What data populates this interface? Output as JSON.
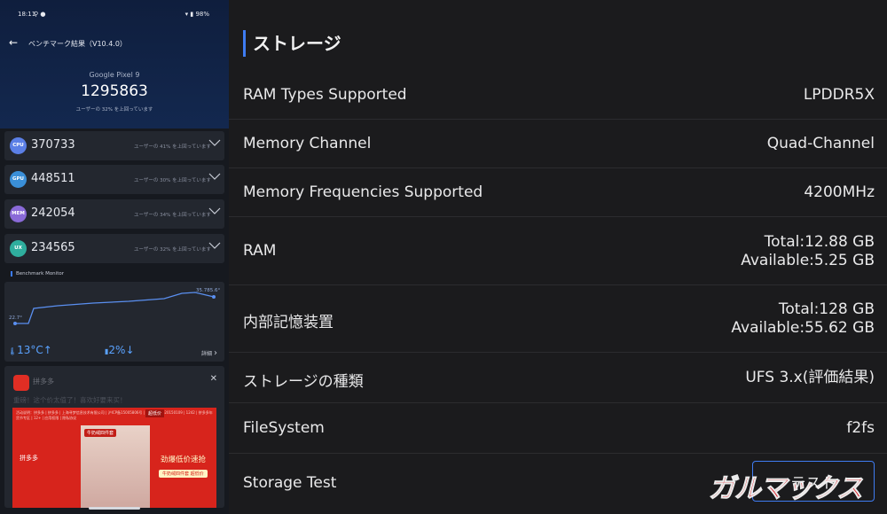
{
  "status_bar": {
    "time": "18:11",
    "battery": "98%"
  },
  "benchmark": {
    "title": "ベンチマーク結果（V10.4.0）",
    "device": "Google Pixel 9",
    "total_score": "1295863",
    "total_sub": "ユーザーの 32% を上回っています",
    "rows": [
      {
        "badge": "CPU",
        "score": "370733",
        "percentile": "ユーザーの 41% を上回っています",
        "color": "#5b7fe6"
      },
      {
        "badge": "GPU",
        "score": "448511",
        "percentile": "ユーザーの 30% を上回っています",
        "color": "#3a8fd8"
      },
      {
        "badge": "MEM",
        "score": "242054",
        "percentile": "ユーザーの 34% を上回っています",
        "color": "#8a6ad8"
      },
      {
        "badge": "UX",
        "score": "234565",
        "percentile": "ユーザーの 32% を上回っています",
        "color": "#2fae9e"
      }
    ]
  },
  "monitor": {
    "label": "Benchmark Monitor",
    "temp_start": "22.7°",
    "temp_end": "35.785.6°",
    "temp_rise": "13°C↑",
    "battery_drop": "2%↓",
    "details": "詳細"
  },
  "ad": {
    "brand": "拼多多",
    "headline": "重磅！这个价太值了！喜欢好要来买！",
    "fineprint": "活动说明：拼多多 | 拼多多 | 上海寻梦信息技术有限公司 | 沪ICP备15005806号 | ICP证沪B2-20150109 | 1242 | 拼多多年货节专区 | 12+ | 应用权限 | 隐私协议",
    "photo_tag": "牛奶绒四件套",
    "deal_badge": "超低价",
    "pdd_logo": "拼多多",
    "promo_line1": "劲爆低价速抢",
    "promo_line2": "牛奶绒四件套 超低价"
  },
  "storage": {
    "section_title": "ストレージ",
    "rows": [
      {
        "label": "RAM Types Supported",
        "value": "LPDDR5X"
      },
      {
        "label": "Memory Channel",
        "value": "Quad-Channel"
      },
      {
        "label": "Memory Frequencies Supported",
        "value": "4200MHz"
      },
      {
        "label": "RAM",
        "value": "Total:12.88 GB",
        "value2": "Available:5.25 GB"
      },
      {
        "label": "内部記憶装置",
        "value": "Total:128 GB",
        "value2": "Available:55.62 GB"
      },
      {
        "label": "ストレージの種類",
        "value": "UFS 3.x(評価結果)"
      },
      {
        "label": "FileSystem",
        "value": "f2fs"
      },
      {
        "label": "Storage Test",
        "button": "テスト"
      }
    ]
  },
  "watermark": "ガルマックス",
  "colors": {
    "accent": "#3f7cf2",
    "background": "#1b1b1d",
    "watermark": "#e8101a"
  }
}
